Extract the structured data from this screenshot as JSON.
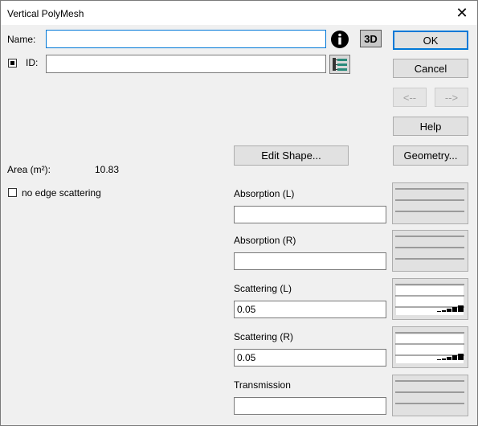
{
  "window": {
    "title": "Vertical PolyMesh",
    "close_glyph": "✕"
  },
  "name": {
    "label": "Name:",
    "value": ""
  },
  "id": {
    "label": "ID:",
    "value": "",
    "checked": true
  },
  "icons": {
    "info": "info-icon",
    "threed": "3D",
    "tree": "tree-list-icon"
  },
  "buttons": {
    "ok": "OK",
    "cancel": "Cancel",
    "prev": "<--",
    "next": "-->",
    "help": "Help",
    "edit_shape": "Edit Shape...",
    "geometry": "Geometry..."
  },
  "area": {
    "label": "Area (m²):",
    "value": "10.83"
  },
  "edge": {
    "label": "no edge scattering",
    "checked": false
  },
  "fields": [
    {
      "label": "Absorption (L)",
      "value": ""
    },
    {
      "label": "Absorption (R)",
      "value": ""
    },
    {
      "label": "Scattering (L)",
      "value": "0.05"
    },
    {
      "label": "Scattering (R)",
      "value": "0.05"
    },
    {
      "label": "Transmission",
      "value": ""
    }
  ]
}
